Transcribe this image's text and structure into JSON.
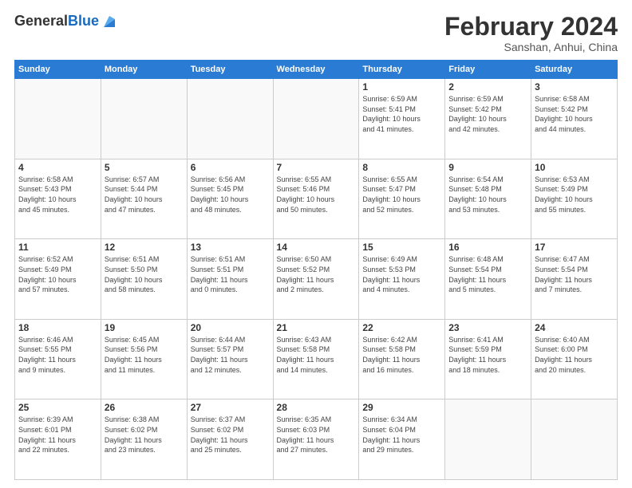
{
  "header": {
    "logo_general": "General",
    "logo_blue": "Blue",
    "month_title": "February 2024",
    "location": "Sanshan, Anhui, China"
  },
  "days_of_week": [
    "Sunday",
    "Monday",
    "Tuesday",
    "Wednesday",
    "Thursday",
    "Friday",
    "Saturday"
  ],
  "weeks": [
    [
      {
        "day": "",
        "info": ""
      },
      {
        "day": "",
        "info": ""
      },
      {
        "day": "",
        "info": ""
      },
      {
        "day": "",
        "info": ""
      },
      {
        "day": "1",
        "info": "Sunrise: 6:59 AM\nSunset: 5:41 PM\nDaylight: 10 hours\nand 41 minutes."
      },
      {
        "day": "2",
        "info": "Sunrise: 6:59 AM\nSunset: 5:42 PM\nDaylight: 10 hours\nand 42 minutes."
      },
      {
        "day": "3",
        "info": "Sunrise: 6:58 AM\nSunset: 5:42 PM\nDaylight: 10 hours\nand 44 minutes."
      }
    ],
    [
      {
        "day": "4",
        "info": "Sunrise: 6:58 AM\nSunset: 5:43 PM\nDaylight: 10 hours\nand 45 minutes."
      },
      {
        "day": "5",
        "info": "Sunrise: 6:57 AM\nSunset: 5:44 PM\nDaylight: 10 hours\nand 47 minutes."
      },
      {
        "day": "6",
        "info": "Sunrise: 6:56 AM\nSunset: 5:45 PM\nDaylight: 10 hours\nand 48 minutes."
      },
      {
        "day": "7",
        "info": "Sunrise: 6:55 AM\nSunset: 5:46 PM\nDaylight: 10 hours\nand 50 minutes."
      },
      {
        "day": "8",
        "info": "Sunrise: 6:55 AM\nSunset: 5:47 PM\nDaylight: 10 hours\nand 52 minutes."
      },
      {
        "day": "9",
        "info": "Sunrise: 6:54 AM\nSunset: 5:48 PM\nDaylight: 10 hours\nand 53 minutes."
      },
      {
        "day": "10",
        "info": "Sunrise: 6:53 AM\nSunset: 5:49 PM\nDaylight: 10 hours\nand 55 minutes."
      }
    ],
    [
      {
        "day": "11",
        "info": "Sunrise: 6:52 AM\nSunset: 5:49 PM\nDaylight: 10 hours\nand 57 minutes."
      },
      {
        "day": "12",
        "info": "Sunrise: 6:51 AM\nSunset: 5:50 PM\nDaylight: 10 hours\nand 58 minutes."
      },
      {
        "day": "13",
        "info": "Sunrise: 6:51 AM\nSunset: 5:51 PM\nDaylight: 11 hours\nand 0 minutes."
      },
      {
        "day": "14",
        "info": "Sunrise: 6:50 AM\nSunset: 5:52 PM\nDaylight: 11 hours\nand 2 minutes."
      },
      {
        "day": "15",
        "info": "Sunrise: 6:49 AM\nSunset: 5:53 PM\nDaylight: 11 hours\nand 4 minutes."
      },
      {
        "day": "16",
        "info": "Sunrise: 6:48 AM\nSunset: 5:54 PM\nDaylight: 11 hours\nand 5 minutes."
      },
      {
        "day": "17",
        "info": "Sunrise: 6:47 AM\nSunset: 5:54 PM\nDaylight: 11 hours\nand 7 minutes."
      }
    ],
    [
      {
        "day": "18",
        "info": "Sunrise: 6:46 AM\nSunset: 5:55 PM\nDaylight: 11 hours\nand 9 minutes."
      },
      {
        "day": "19",
        "info": "Sunrise: 6:45 AM\nSunset: 5:56 PM\nDaylight: 11 hours\nand 11 minutes."
      },
      {
        "day": "20",
        "info": "Sunrise: 6:44 AM\nSunset: 5:57 PM\nDaylight: 11 hours\nand 12 minutes."
      },
      {
        "day": "21",
        "info": "Sunrise: 6:43 AM\nSunset: 5:58 PM\nDaylight: 11 hours\nand 14 minutes."
      },
      {
        "day": "22",
        "info": "Sunrise: 6:42 AM\nSunset: 5:58 PM\nDaylight: 11 hours\nand 16 minutes."
      },
      {
        "day": "23",
        "info": "Sunrise: 6:41 AM\nSunset: 5:59 PM\nDaylight: 11 hours\nand 18 minutes."
      },
      {
        "day": "24",
        "info": "Sunrise: 6:40 AM\nSunset: 6:00 PM\nDaylight: 11 hours\nand 20 minutes."
      }
    ],
    [
      {
        "day": "25",
        "info": "Sunrise: 6:39 AM\nSunset: 6:01 PM\nDaylight: 11 hours\nand 22 minutes."
      },
      {
        "day": "26",
        "info": "Sunrise: 6:38 AM\nSunset: 6:02 PM\nDaylight: 11 hours\nand 23 minutes."
      },
      {
        "day": "27",
        "info": "Sunrise: 6:37 AM\nSunset: 6:02 PM\nDaylight: 11 hours\nand 25 minutes."
      },
      {
        "day": "28",
        "info": "Sunrise: 6:35 AM\nSunset: 6:03 PM\nDaylight: 11 hours\nand 27 minutes."
      },
      {
        "day": "29",
        "info": "Sunrise: 6:34 AM\nSunset: 6:04 PM\nDaylight: 11 hours\nand 29 minutes."
      },
      {
        "day": "",
        "info": ""
      },
      {
        "day": "",
        "info": ""
      }
    ]
  ]
}
